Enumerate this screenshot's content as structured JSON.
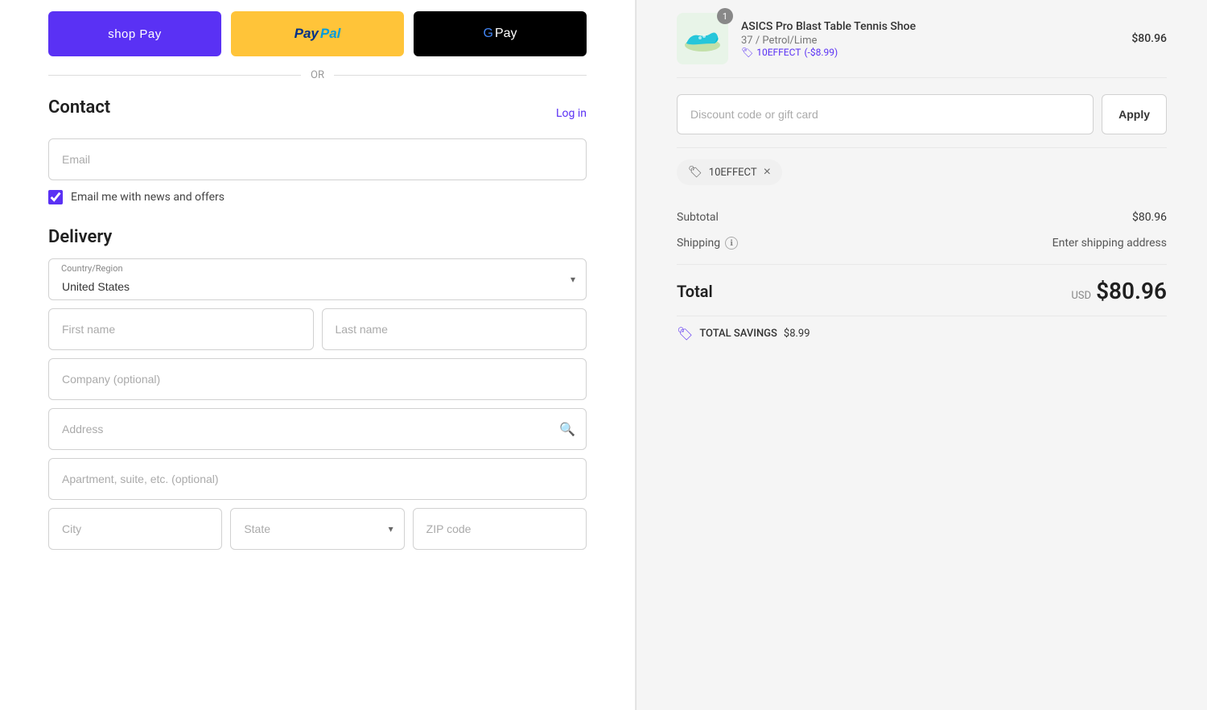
{
  "payment": {
    "shop_pay_label": "shop Pay",
    "paypal_label": "PayPal",
    "gpay_label": "G Pay",
    "or_label": "OR"
  },
  "contact": {
    "title": "Contact",
    "log_in_label": "Log in",
    "email_placeholder": "Email",
    "checkbox_label": "Email me with news and offers",
    "checkbox_checked": true
  },
  "delivery": {
    "title": "Delivery",
    "country_label": "Country/Region",
    "country_value": "United States",
    "first_name_placeholder": "First name",
    "last_name_placeholder": "Last name",
    "company_placeholder": "Company (optional)",
    "address_placeholder": "Address",
    "apartment_placeholder": "Apartment, suite, etc. (optional)",
    "city_placeholder": "City",
    "state_placeholder": "State",
    "zip_placeholder": "ZIP code"
  },
  "order": {
    "product": {
      "name": "ASICS Pro Blast Table Tennis Shoe",
      "variant": "37 / Petrol/Lime",
      "discount_code": "10EFFECT",
      "discount_amount": "(-$8.99)",
      "price": "$80.96",
      "badge_count": "1"
    },
    "discount": {
      "input_placeholder": "Discount code or gift card",
      "apply_label": "Apply"
    },
    "coupon": {
      "code": "10EFFECT",
      "icon": "🏷",
      "remove_label": "×"
    },
    "subtotal_label": "Subtotal",
    "subtotal_value": "$80.96",
    "shipping_label": "Shipping",
    "shipping_value": "Enter shipping address",
    "total_label": "Total",
    "total_currency": "USD",
    "total_value": "$80.96",
    "savings_label": "TOTAL SAVINGS",
    "savings_value": "$8.99"
  }
}
